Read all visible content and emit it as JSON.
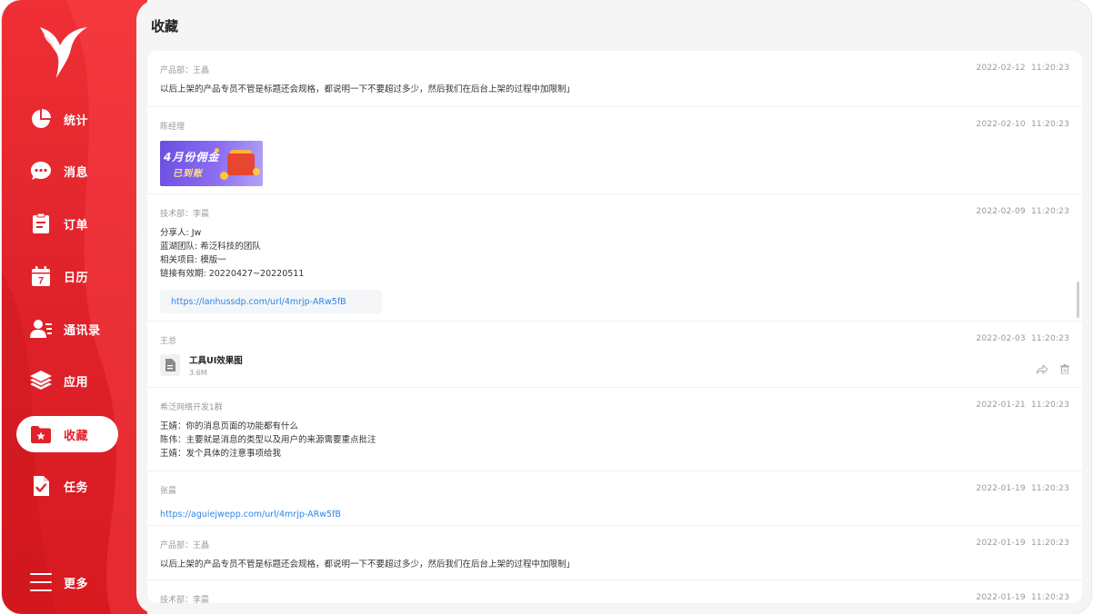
{
  "sidebar": {
    "items": [
      {
        "label": "统计",
        "icon": "pie-chart-icon"
      },
      {
        "label": "消息",
        "icon": "chat-bubble-icon"
      },
      {
        "label": "订单",
        "icon": "clipboard-icon"
      },
      {
        "label": "日历",
        "icon": "calendar-icon"
      },
      {
        "label": "通讯录",
        "icon": "contacts-icon"
      },
      {
        "label": "应用",
        "icon": "layers-icon"
      },
      {
        "label": "收藏",
        "icon": "favorite-folder-icon"
      },
      {
        "label": "任务",
        "icon": "task-check-icon"
      }
    ],
    "more_label": "更多",
    "calendar_day": "7",
    "accent": "#e0232b"
  },
  "page": {
    "title": "收藏"
  },
  "favorites": [
    {
      "sender": "产品部：王晶",
      "date": "2022-02-12",
      "time": "11:20:23",
      "text": "以后上架的产品专员不管是标题还会规格，都说明一下不要超过多少，然后我们在后台上架的过程中加限制」"
    },
    {
      "sender": "陈经理",
      "date": "2022-02-10",
      "time": "11:20:23",
      "banner_line1": "4月份佣金",
      "banner_line2": "已到账"
    },
    {
      "sender": "技术部：李晨",
      "date": "2022-02-09",
      "time": "11:20:23",
      "lines": [
        "分享人: Jw",
        "蓝湖团队: 希泛科技的团队",
        "相关项目: 模版一",
        "链接有效期: 20220427~20220511"
      ],
      "link": "https://lanhussdp.com/url/4mrjp-ARw5fB"
    },
    {
      "sender": "王总",
      "date": "2022-02-03",
      "time": "11:20:23",
      "file_name": "工具UI效果图",
      "file_size": "3.6M"
    },
    {
      "sender": "希泛网络开发1群",
      "date": "2022-01-21",
      "time": "11:20:23",
      "lines": [
        "王婧：你的消息页面的功能都有什么",
        "陈伟：主要就是消息的类型以及用户的来源需要重点批注",
        "王婧：发个具体的注意事项给我"
      ]
    },
    {
      "sender": "张晨",
      "date": "2022-01-19",
      "time": "11:20:23",
      "link": "https://aguiejwepp.com/url/4mrjp-ARw5fB"
    },
    {
      "sender": "产品部：王晶",
      "date": "2022-01-19",
      "time": "11:20:23",
      "text": "以后上架的产品专员不管是标题还会规格，都说明一下不要超过多少，然后我们在后台上架的过程中加限制」"
    },
    {
      "sender": "技术部：李晨",
      "date": "2022-01-19",
      "time": "11:20:23"
    }
  ]
}
